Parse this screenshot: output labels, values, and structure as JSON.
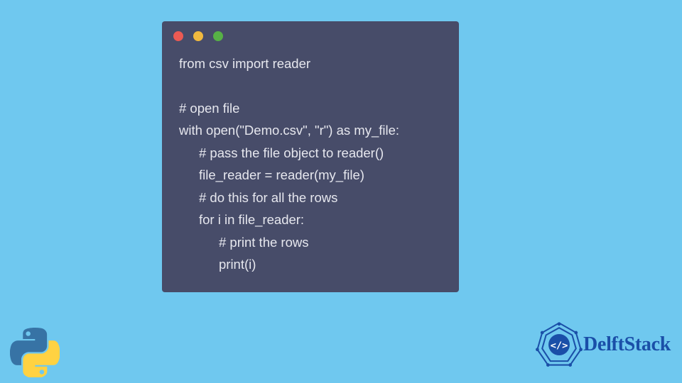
{
  "code": {
    "lines": [
      {
        "text": "from csv import reader",
        "indent": 0
      },
      {
        "text": "",
        "indent": 0
      },
      {
        "text": "# open file",
        "indent": 0
      },
      {
        "text": "with open(\"Demo.csv\", \"r\") as my_file:",
        "indent": 0
      },
      {
        "text": "# pass the file object to reader()",
        "indent": 1
      },
      {
        "text": "file_reader = reader(my_file)",
        "indent": 1
      },
      {
        "text": "# do this for all the rows",
        "indent": 1
      },
      {
        "text": "for i in file_reader:",
        "indent": 1
      },
      {
        "text": "# print the rows",
        "indent": 2
      },
      {
        "text": "print(i)",
        "indent": 2
      }
    ]
  },
  "brand": {
    "text": "DelftStack"
  },
  "colors": {
    "background": "#6fc8ef",
    "window": "#474c69",
    "code_text": "#e6e7ee",
    "dot_red": "#ec5a53",
    "dot_yellow": "#f1b93f",
    "dot_green": "#57b146",
    "brand_blue": "#1a4fa8"
  }
}
